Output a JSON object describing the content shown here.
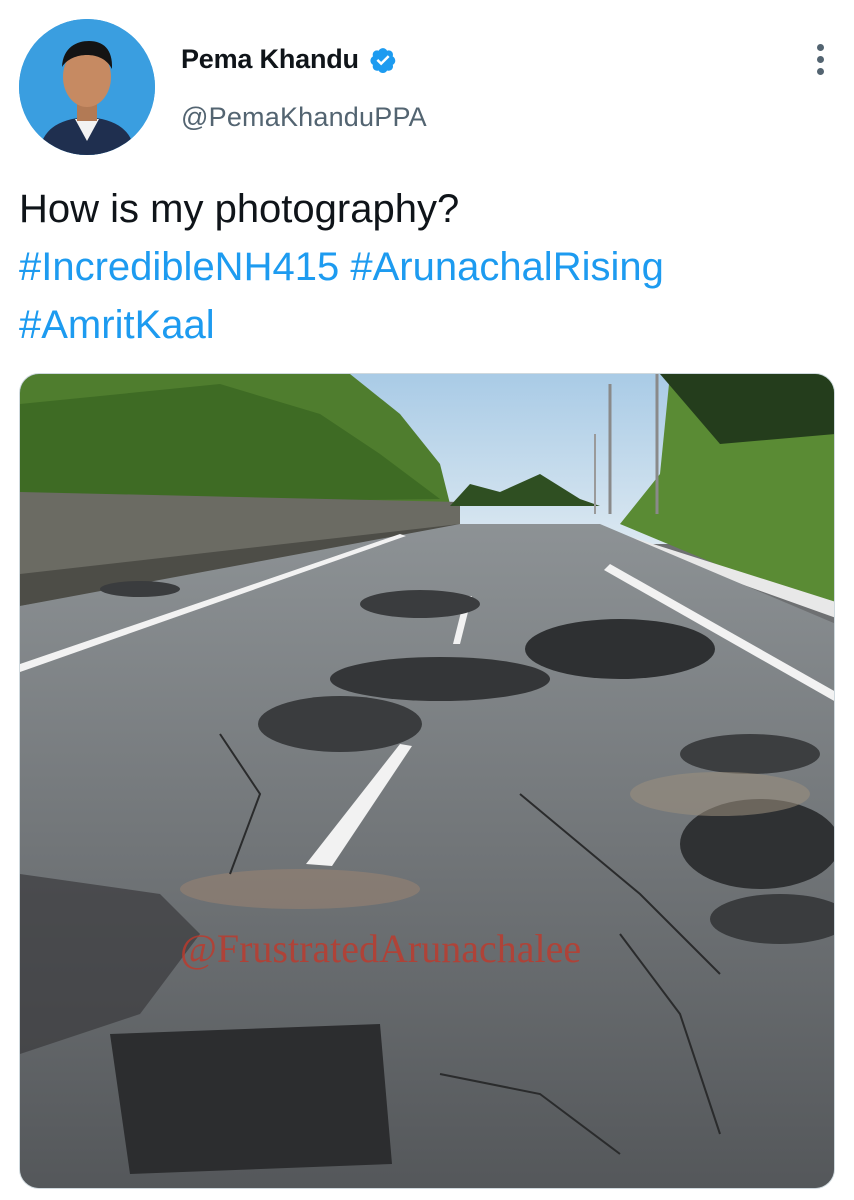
{
  "tweet": {
    "author": {
      "display_name": "Pema Khandu",
      "handle": "@PemaKhanduPPA",
      "verified": true
    },
    "text": "How is my photography?",
    "hashtags": [
      "#IncredibleNH415",
      "#ArunachalRising",
      "#AmritKaal"
    ],
    "media": {
      "watermark": "@FrustratedArunachalee"
    }
  },
  "icons": {
    "verified": "verified-badge-icon",
    "more": "more-options-icon"
  },
  "colors": {
    "hashtag": "#1d9bf0",
    "verified": "#1d9bf0",
    "secondary_text": "#536471",
    "watermark": "#c0392b"
  }
}
